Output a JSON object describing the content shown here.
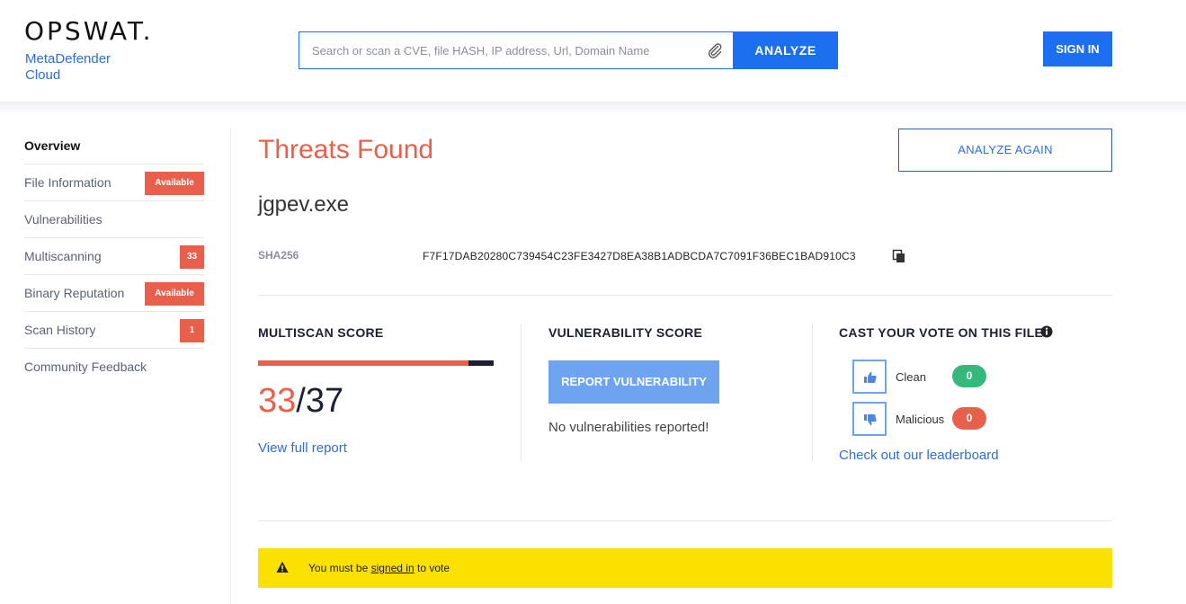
{
  "brand": {
    "logo_text": "OPSWAT.",
    "product_line1": "MetaDefender",
    "product_line2": "Cloud"
  },
  "header": {
    "search_placeholder": "Search or scan a CVE, file HASH, IP address, Url, Domain Name",
    "analyze_label": "ANALYZE",
    "sign_in_label": "SIGN IN",
    "accent_color": "#1d6ff1"
  },
  "sidebar": {
    "items": [
      {
        "label": "Overview",
        "badge": ""
      },
      {
        "label": "File Information",
        "badge": "Available"
      },
      {
        "label": "Vulnerabilities",
        "badge": ""
      },
      {
        "label": "Multiscanning",
        "badge": "33"
      },
      {
        "label": "Binary Reputation",
        "badge": "Available"
      },
      {
        "label": "Scan History",
        "badge": "1"
      },
      {
        "label": "Community Feedback",
        "badge": ""
      }
    ]
  },
  "main": {
    "title": "Threats Found",
    "analyze_again_label": "ANALYZE AGAIN",
    "filename": "jgpev.exe",
    "sha_label": "SHA256",
    "sha_value": "F7F17DAB20280C739454C23FE3427D8EA38B1ADBCDA7C7091F36BEC1BAD910C3",
    "threat_color": "#e8604c"
  },
  "multiscan": {
    "title": "MULTISCAN SCORE",
    "detected": "33",
    "separator": "/",
    "total": "37",
    "detected_fraction": 0.892,
    "view_report_label": "View full report"
  },
  "vulnerability": {
    "title": "VULNERABILITY SCORE",
    "report_label": "REPORT VULNERABILITY",
    "status_text": "No vulnerabilities reported!"
  },
  "vote": {
    "title": "CAST YOUR VOTE ON THIS FILE",
    "clean_label": "Clean",
    "clean_count": "0",
    "clean_color": "#34b97a",
    "malicious_label": "Malicious",
    "malicious_count": "0",
    "malicious_color": "#e8604c",
    "leaderboard_label": "Check out our leaderboard"
  },
  "banner": {
    "prefix": "You must be ",
    "link": "signed in",
    "suffix": " to vote",
    "color": "#fbe100"
  }
}
